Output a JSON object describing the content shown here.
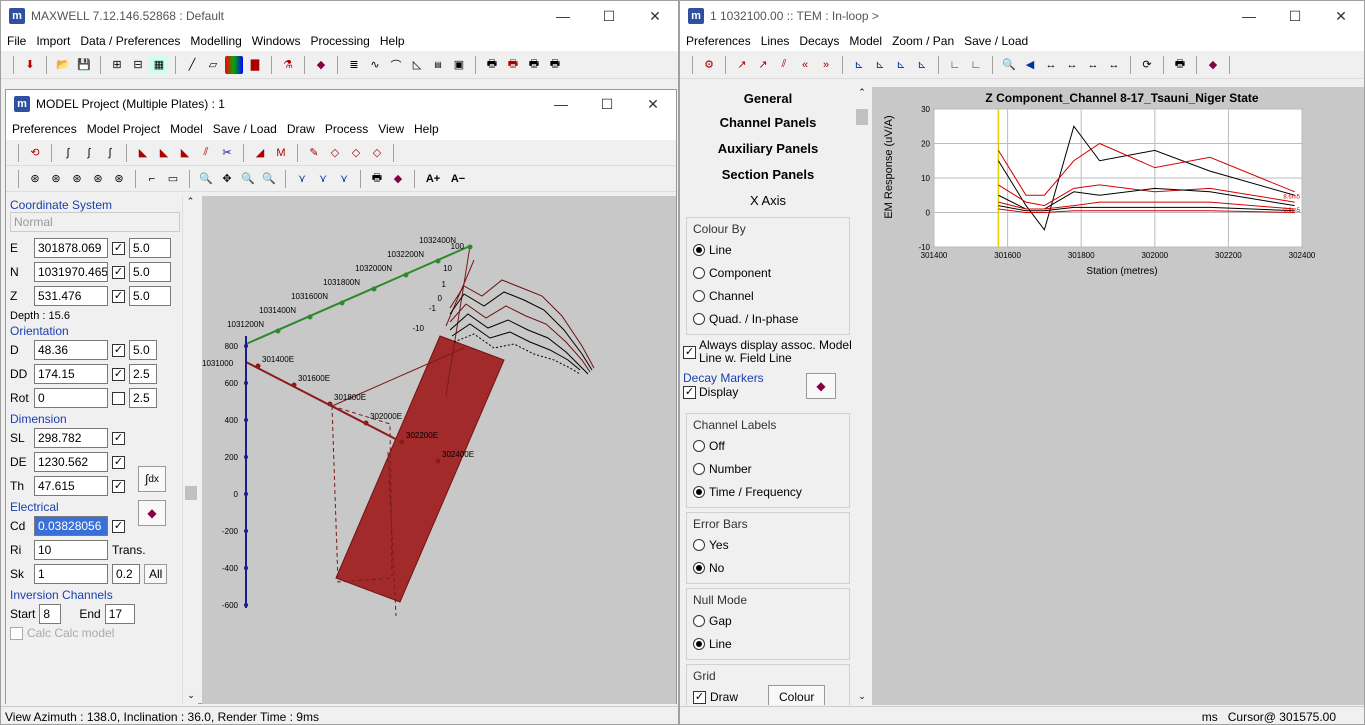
{
  "left_window": {
    "title": "MAXWELL 7.12.146.52868 : Default",
    "menu": [
      "File",
      "Import",
      "Data / Preferences",
      "Modelling",
      "Windows",
      "Processing",
      "Help"
    ]
  },
  "model_window": {
    "title": "MODEL Project (Multiple Plates) : 1",
    "menu": [
      "Preferences",
      "Model Project",
      "Model",
      "Save / Load",
      "Draw",
      "Process",
      "View",
      "Help"
    ],
    "font_buttons": [
      "A+",
      "A−"
    ]
  },
  "properties": {
    "coord_system_label": "Coordinate System",
    "coord_system_value": "Normal",
    "e": {
      "label": "E",
      "value": "301878.069",
      "step": "5.0"
    },
    "n": {
      "label": "N",
      "value": "1031970.465",
      "step": "5.0"
    },
    "z": {
      "label": "Z",
      "value": "531.476",
      "step": "5.0"
    },
    "depth": "Depth : 15.6",
    "orientation_label": "Orientation",
    "d": {
      "label": "D",
      "value": "48.36",
      "step": "5.0"
    },
    "dd": {
      "label": "DD",
      "value": "174.15",
      "step": "2.5"
    },
    "rot": {
      "label": "Rot",
      "value": "0",
      "step": "2.5"
    },
    "dimension_label": "Dimension",
    "sl": {
      "label": "SL",
      "value": "298.782"
    },
    "de": {
      "label": "DE",
      "value": "1230.562"
    },
    "th": {
      "label": "Th",
      "value": "47.615"
    },
    "electrical_label": "Electrical",
    "cd": {
      "label": "Cd",
      "value": "0.03828056"
    },
    "ri": {
      "label": "Ri",
      "value": "10",
      "suffix": "Trans."
    },
    "sk": {
      "label": "Sk",
      "value": "1",
      "value2": "0.2",
      "all": "All"
    },
    "inversion_label": "Inversion Channels",
    "start_label": "Start",
    "start_value": "8",
    "end_label": "End",
    "end_value": "17",
    "calc_label": "Calc Calc model"
  },
  "viewport": {
    "stations_n": [
      "1032400N",
      "1032200N",
      "1032000N",
      "1031800N",
      "1031600N",
      "1031400N",
      "1031200N"
    ],
    "stations_e": [
      "301400E",
      "301600E",
      "301800E",
      "302000E",
      "302200E",
      "302400E"
    ],
    "corner_label": "1031000",
    "z_ticks": [
      "800",
      "600",
      "400",
      "200",
      "0",
      "-200",
      "-400",
      "-600"
    ],
    "profile_ticks": [
      "100",
      "10",
      "1",
      "0",
      "-1",
      "-10"
    ]
  },
  "left_status": "View Azimuth : 138.0, Inclination : 36.0, Render Time : 9ms",
  "right_window": {
    "title": "1 1032100.00 :: TEM : In-loop >",
    "menu": [
      "Preferences",
      "Lines",
      "Decays",
      "Model",
      "Zoom / Pan",
      "Save / Load"
    ]
  },
  "nav": {
    "general": "General",
    "channel_panels": "Channel Panels",
    "auxiliary_panels": "Auxiliary Panels",
    "section_panels": "Section Panels",
    "x_axis": "X Axis"
  },
  "options": {
    "colour_by": {
      "title": "Colour By",
      "items": [
        "Line",
        "Component",
        "Channel",
        "Quad. / In-phase"
      ],
      "selected": 0
    },
    "always_display": "Always display assoc. Model Line w. Field Line",
    "decay_markers": {
      "title": "Decay Markers",
      "display": "Display"
    },
    "channel_labels": {
      "title": "Channel Labels",
      "items": [
        "Off",
        "Number",
        "Time / Frequency"
      ],
      "selected": 2
    },
    "error_bars": {
      "title": "Error Bars",
      "items": [
        "Yes",
        "No"
      ],
      "selected": 1
    },
    "null_mode": {
      "title": "Null Mode",
      "items": [
        "Gap",
        "Line"
      ],
      "selected": 1
    },
    "grid": {
      "title": "Grid",
      "draw": "Draw",
      "colour": "Colour"
    }
  },
  "chart_data": {
    "type": "line",
    "title": "Z Component_Channel 8-17_Tsauni_Niger State",
    "xlabel": "Station (metres)",
    "ylabel": "EM Response (uV/A)",
    "xlim": [
      301400,
      302400
    ],
    "ylim": [
      -10,
      30
    ],
    "xticks": [
      301400,
      301600,
      301800,
      302000,
      302200,
      302400
    ],
    "yticks": [
      30,
      20,
      10,
      0,
      -10
    ],
    "cursor_x": 301575,
    "series": [
      {
        "color": "#000000",
        "x": [
          301575,
          301650,
          301700,
          301780,
          301850,
          302000,
          302150,
          302380
        ],
        "y": [
          15,
          2,
          -5,
          25,
          15,
          18,
          12,
          5
        ]
      },
      {
        "color": "#d40000",
        "x": [
          301575,
          301650,
          301700,
          301780,
          301850,
          302000,
          302150,
          302380
        ],
        "y": [
          18,
          5,
          5,
          15,
          20,
          13,
          16,
          6
        ]
      },
      {
        "color": "#d40000",
        "x": [
          301575,
          301650,
          301700,
          301780,
          301850,
          302000,
          302150,
          302380
        ],
        "y": [
          8,
          3,
          2,
          7,
          8,
          6,
          7,
          3
        ]
      },
      {
        "color": "#000000",
        "x": [
          301575,
          301650,
          301700,
          301780,
          301850,
          302000,
          302150,
          302380
        ],
        "y": [
          5,
          1,
          1,
          6,
          5,
          7,
          6,
          2
        ]
      },
      {
        "color": "#d40000",
        "x": [
          301575,
          301650,
          301700,
          301780,
          301850,
          302000,
          302150,
          302380
        ],
        "y": [
          3,
          1,
          1,
          2,
          3,
          3,
          3,
          1
        ]
      },
      {
        "color": "#000000",
        "x": [
          301575,
          301650,
          301700,
          301780,
          301850,
          302000,
          302150,
          302380
        ],
        "y": [
          2,
          0.5,
          0.5,
          1.5,
          1.5,
          1.5,
          1.5,
          0.5
        ]
      },
      {
        "color": "#d40000",
        "x": [
          301575,
          301650,
          301700,
          301780,
          301850,
          302000,
          302150,
          302380
        ],
        "y": [
          1,
          0,
          0,
          0.5,
          0.5,
          0.5,
          0.5,
          0
        ]
      }
    ],
    "end_labels": [
      "8.6m5",
      "0.8m5"
    ]
  },
  "right_status": {
    "units": "ms",
    "cursor": "Cursor@ 301575.00"
  }
}
